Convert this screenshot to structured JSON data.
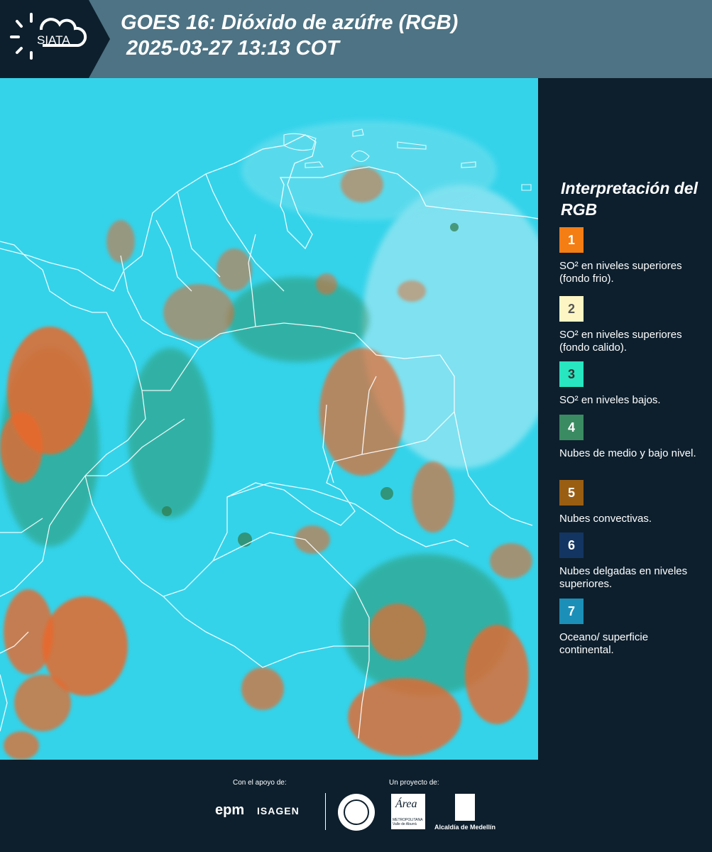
{
  "header": {
    "title": "GOES 16: Dióxido de azúfre (RGB)\n 2025-03-27 13:13 COT",
    "logo_text": "SIATA"
  },
  "legend": {
    "title": "Interpretación del RGB",
    "items": [
      {
        "number": "1",
        "color": "#f47d14",
        "number_color": "#ffffff",
        "label": "SO² en niveles superiores (fondo frio)."
      },
      {
        "number": "2",
        "color": "#fdf6c4",
        "number_color": "#555555",
        "label": "SO² en niveles superiores (fondo calido)."
      },
      {
        "number": "3",
        "color": "#27e6c0",
        "number_color": "#333333",
        "label": "SO² en niveles bajos."
      },
      {
        "number": "4",
        "color": "#3a8b62",
        "number_color": "#ffffff",
        "label": "Nubes de medio y bajo nivel."
      },
      {
        "number": "5",
        "color": "#9a5e12",
        "number_color": "#ffffff",
        "label": "Nubes convectivas."
      },
      {
        "number": "6",
        "color": "#133562",
        "number_color": "#ffffff",
        "label": "Nubes delgadas en niveles superiores."
      },
      {
        "number": "7",
        "color": "#1b8fb8",
        "number_color": "#ffffff",
        "label": "Oceano/ superficie continental."
      }
    ]
  },
  "footer": {
    "support_label": "Con el apoyo de:",
    "project_label": "Un proyecto de:",
    "sponsors": [
      "epm",
      "ISAGEN"
    ],
    "partners": [
      "Área Metropolitana Valle de Aburrá",
      "Alcaldía de Medellín"
    ],
    "area_logo_text": "Área",
    "area_logo_subtext": "METROPOLITANA Valle de Aburrá",
    "alcaldia_label": "Alcaldía de Medellín"
  },
  "map": {
    "colors": {
      "background": "#34d3ea",
      "clouds_orange": "#e8682a",
      "clouds_green": "#2f8a55",
      "borders": "#ffffff"
    }
  }
}
